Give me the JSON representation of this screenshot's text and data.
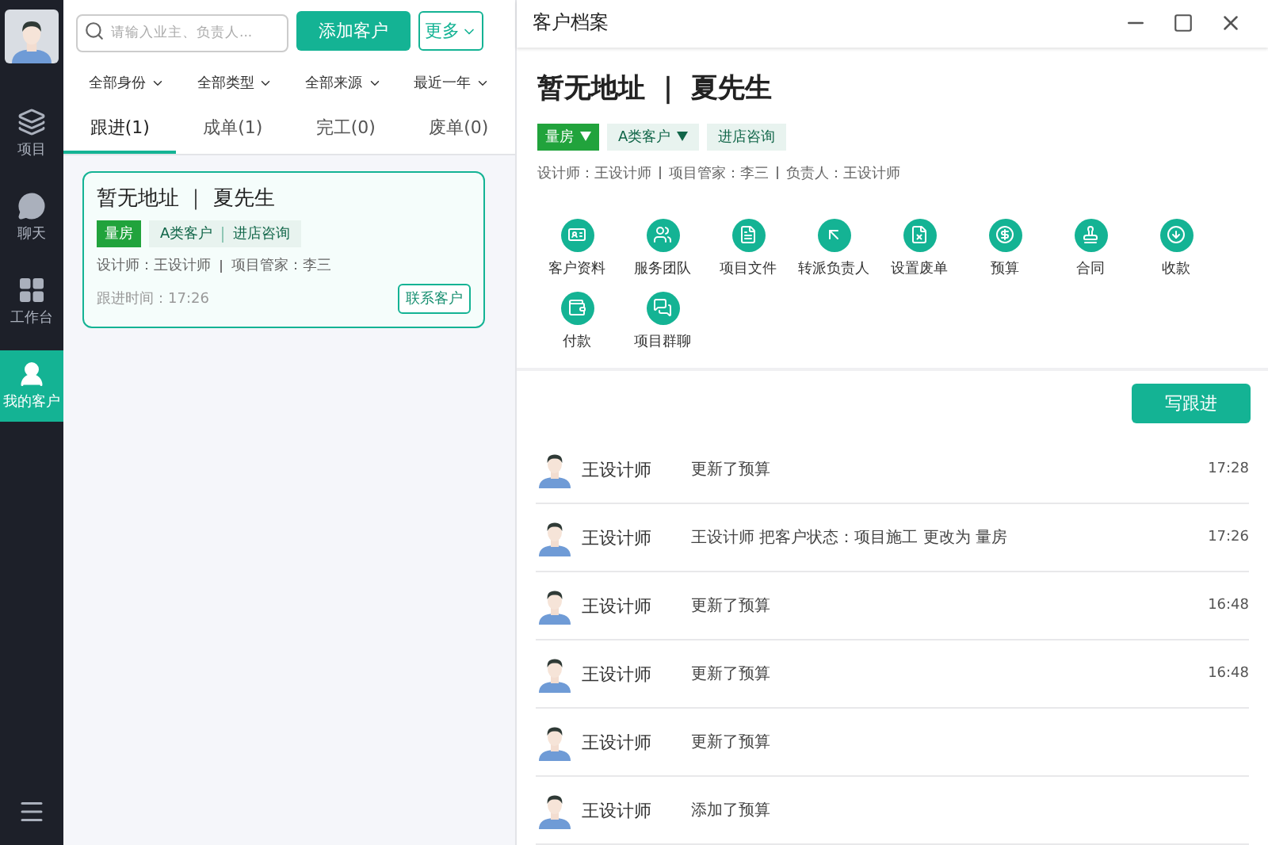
{
  "sidebar": {
    "items": [
      {
        "label": "项目",
        "selected": false
      },
      {
        "label": "聊天",
        "selected": false
      },
      {
        "label": "工作台",
        "selected": false
      },
      {
        "label": "我的客户",
        "selected": true
      }
    ]
  },
  "toolbar": {
    "search": {
      "placeholder": "请输入业主、负责人..."
    },
    "add_button": "添加客户",
    "more_button": "更多"
  },
  "filters": [
    "全部身份",
    "全部类型",
    "全部来源",
    "最近一年"
  ],
  "tabs": [
    {
      "label": "跟进(1)",
      "selected": true
    },
    {
      "label": "成单(1)",
      "selected": false
    },
    {
      "label": "完工(0)",
      "selected": false
    },
    {
      "label": "废单(0)",
      "selected": false
    }
  ],
  "customer_cards": [
    {
      "title": "暂无地址 ｜ 夏先生",
      "selected": true,
      "status_tag": "量房",
      "tags": [
        "A类客户",
        "进店咨询"
      ],
      "designer": "设计师：王设计师",
      "manager": "项目管家：李三",
      "follow_time": "跟进时间：17:26",
      "contact_button": "联系客户"
    }
  ],
  "detail": {
    "window_title": "客户档案",
    "heading": "暂无地址 ｜ 夏先生",
    "tags": [
      {
        "kind": "status",
        "label": "量房",
        "dropdown": true
      },
      {
        "kind": "category",
        "label": "A类客户",
        "dropdown": true
      },
      {
        "kind": "category",
        "label": "进店咨询",
        "dropdown": false
      }
    ],
    "info": [
      "设计师：王设计师",
      "项目管家：李三",
      "负责人：王设计师"
    ],
    "actions": [
      "客户资料",
      "服务团队",
      "项目文件",
      "转派负责人",
      "设置废单",
      "预算",
      "合同",
      "收款",
      "付款",
      "项目群聊"
    ],
    "write_button": "写跟进",
    "records": [
      {
        "name": "王设计师",
        "action": "更新了预算",
        "time": "17:28"
      },
      {
        "name": "王设计师",
        "action": "王设计师 把客户状态：项目施工 更改为 量房",
        "time": "17:26"
      },
      {
        "name": "王设计师",
        "action": "更新了预算",
        "time": "16:48"
      },
      {
        "name": "王设计师",
        "action": "更新了预算",
        "time": "16:48"
      },
      {
        "name": "王设计师",
        "action": "更新了预算"
      },
      {
        "name": "王设计师",
        "action": "添加了预算"
      }
    ]
  }
}
